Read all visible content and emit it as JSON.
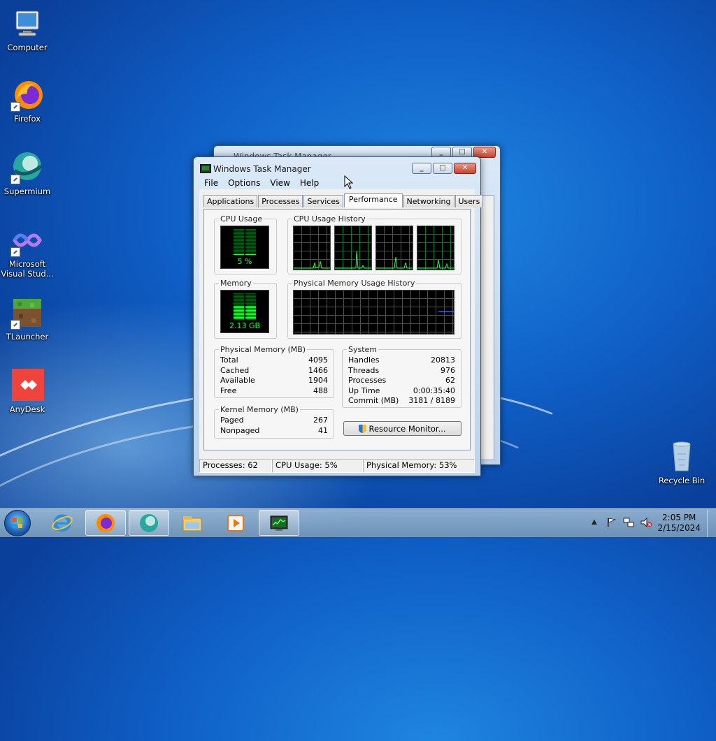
{
  "desktop": {
    "icons": [
      {
        "label": "Computer",
        "icon": "computer-icon"
      },
      {
        "label": "Firefox",
        "icon": "firefox-icon"
      },
      {
        "label": "Supermium",
        "icon": "supermium-icon"
      },
      {
        "label_line1": "Microsoft",
        "label_line2": "Visual Stud...",
        "icon": "visual-studio-icon"
      },
      {
        "label": "TLauncher",
        "icon": "tlauncher-icon"
      },
      {
        "label": "AnyDesk",
        "icon": "anydesk-icon"
      },
      {
        "label": "Recycle Bin",
        "icon": "recycle-bin-icon"
      }
    ]
  },
  "back_window": {
    "title": "Windows Task Manager"
  },
  "task_manager": {
    "title": "Windows Task Manager",
    "menu": [
      "File",
      "Options",
      "View",
      "Help"
    ],
    "tabs": [
      "Applications",
      "Processes",
      "Services",
      "Performance",
      "Networking",
      "Users"
    ],
    "active_tab": "Performance",
    "cpu_usage": {
      "label": "CPU Usage",
      "value": "5 %",
      "fraction": 0.05
    },
    "cpu_history": {
      "label": "CPU Usage History",
      "cores": 4
    },
    "memory": {
      "label": "Memory",
      "value": "2.13 GB",
      "fraction": 0.53
    },
    "memory_history": {
      "label": "Physical Memory Usage History"
    },
    "physical_memory": {
      "label": "Physical Memory (MB)",
      "rows": [
        {
          "k": "Total",
          "v": "4095"
        },
        {
          "k": "Cached",
          "v": "1466"
        },
        {
          "k": "Available",
          "v": "1904"
        },
        {
          "k": "Free",
          "v": "488"
        }
      ]
    },
    "kernel_memory": {
      "label": "Kernel Memory (MB)",
      "rows": [
        {
          "k": "Paged",
          "v": "267"
        },
        {
          "k": "Nonpaged",
          "v": "41"
        }
      ]
    },
    "system": {
      "label": "System",
      "rows": [
        {
          "k": "Handles",
          "v": "20813"
        },
        {
          "k": "Threads",
          "v": "976"
        },
        {
          "k": "Processes",
          "v": "62"
        },
        {
          "k": "Up Time",
          "v": "0:00:35:40"
        },
        {
          "k": "Commit (MB)",
          "v": "3181 / 8189"
        }
      ]
    },
    "resource_monitor_button": "Resource Monitor...",
    "status": {
      "processes": "Processes: 62",
      "cpu": "CPU Usage: 5%",
      "memory": "Physical Memory: 53%"
    }
  },
  "taskbar": {
    "clock_time": "2:05 PM",
    "clock_date": "2/15/2024",
    "items": [
      "start-orb-icon",
      "internet-explorer-icon",
      "firefox-icon",
      "supermium-icon",
      "file-explorer-icon",
      "media-player-icon",
      "task-manager-icon"
    ]
  },
  "colors": {
    "meter_green": "#22ff44",
    "graph_grid": "#0b7a30",
    "mem_line": "#3060ff"
  }
}
